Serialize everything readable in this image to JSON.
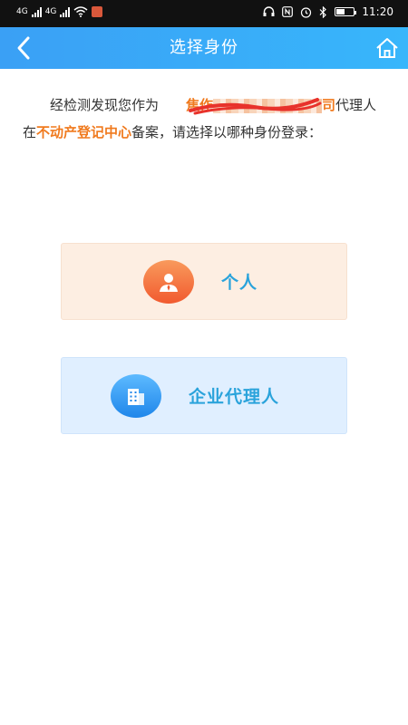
{
  "status_bar": {
    "network_1": "4G",
    "network_2": "4G",
    "time": "11:20",
    "battery_percent": 45
  },
  "nav": {
    "title": "选择身份",
    "back_icon": "chevron-left-icon",
    "home_icon": "home-icon"
  },
  "notice": {
    "prefix": "经检测发现您作为",
    "company_start": "焦作",
    "company_end": "司",
    "middle": "代理人在",
    "center_name": "不动产登记中心",
    "suffix": "备案，请选择以哪种身份登录："
  },
  "roles": [
    {
      "label": "个人",
      "icon": "person-icon"
    },
    {
      "label": "企业代理人",
      "icon": "building-icon"
    }
  ],
  "colors": {
    "nav_bg": "#3aa0f5",
    "highlight": "#f07a1e",
    "role_label": "#2aa3db",
    "personal_bg": "#fdeee2",
    "agent_bg": "#e0efff"
  }
}
